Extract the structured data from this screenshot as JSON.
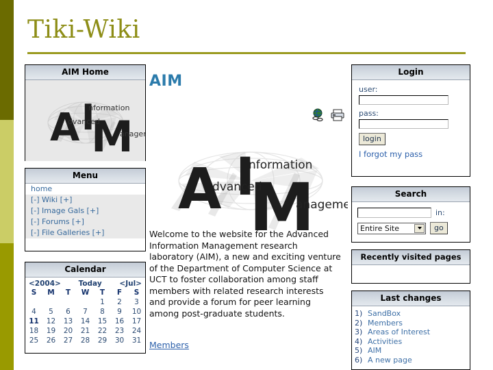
{
  "site": {
    "title": "Tiki-Wiki",
    "accent_color": "#8d8d16",
    "rule_color": "#9a9a1e",
    "strip_colors": [
      "#6b6b00",
      "#cbcd66",
      "#999a00"
    ]
  },
  "aim_home": {
    "title": "AIM Home",
    "logo_alt": "AIM logo",
    "logo_words": [
      "Advanced",
      "Information",
      "Management"
    ],
    "logo_letters": [
      "A",
      "I",
      "M"
    ]
  },
  "menu": {
    "title": "Menu",
    "items": [
      {
        "label": "home",
        "shaded": false
      },
      {
        "label": "[-] Wiki [+]",
        "shaded": true
      },
      {
        "label": "[-] Image Gals [+]",
        "shaded": true
      },
      {
        "label": "[-] Forums [+]",
        "shaded": true
      },
      {
        "label": "[-] File Galleries [+]",
        "shaded": true
      }
    ]
  },
  "calendar": {
    "title": "Calendar",
    "year_nav": "<2004>",
    "today_label": "Today",
    "month_nav": "<Jul>",
    "daynames": [
      "S",
      "M",
      "T",
      "W",
      "T",
      "F",
      "S"
    ],
    "today": 11,
    "weeks": [
      [
        "",
        "",
        "",
        "",
        "1",
        "2",
        "3"
      ],
      [
        "4",
        "5",
        "6",
        "7",
        "8",
        "9",
        "10"
      ],
      [
        "11",
        "12",
        "13",
        "14",
        "15",
        "16",
        "17"
      ],
      [
        "18",
        "19",
        "20",
        "21",
        "22",
        "23",
        "24"
      ],
      [
        "25",
        "26",
        "27",
        "28",
        "29",
        "30",
        "31"
      ]
    ]
  },
  "main": {
    "heading": "AIM",
    "heading_color": "#2b7bab",
    "icons": [
      "globe-link-icon",
      "printer-icon"
    ],
    "logo_words": [
      "Advanced",
      "Information",
      "Management"
    ],
    "logo_letters": [
      "A",
      "I",
      "M"
    ],
    "body_text": "Welcome to the website for the Advanced Information Management research laboratory (AIM), a new and exciting venture of the Department of Computer Science at UCT to foster collaboration among staff members with related research interests and provide a forum for peer learning among post-graduate students.",
    "link": "Members"
  },
  "login": {
    "title": "Login",
    "user_label": "user:",
    "user_value": "",
    "pass_label": "pass:",
    "pass_value": "",
    "button": "login",
    "forgot_link": "I forgot my pass"
  },
  "search": {
    "title": "Search",
    "query": "",
    "in_label": "in:",
    "scope_selected": "Entire Site",
    "scope_options": [
      "Entire Site"
    ],
    "go_button": "go"
  },
  "recent": {
    "title": "Recently visited pages",
    "items": []
  },
  "last_changes": {
    "title": "Last changes",
    "items": [
      {
        "num": "1)",
        "label": "SandBox"
      },
      {
        "num": "2)",
        "label": "Members"
      },
      {
        "num": "3)",
        "label": "Areas of Interest"
      },
      {
        "num": "4)",
        "label": "Activities"
      },
      {
        "num": "5)",
        "label": "AIM"
      },
      {
        "num": "6)",
        "label": "A new page"
      }
    ]
  }
}
